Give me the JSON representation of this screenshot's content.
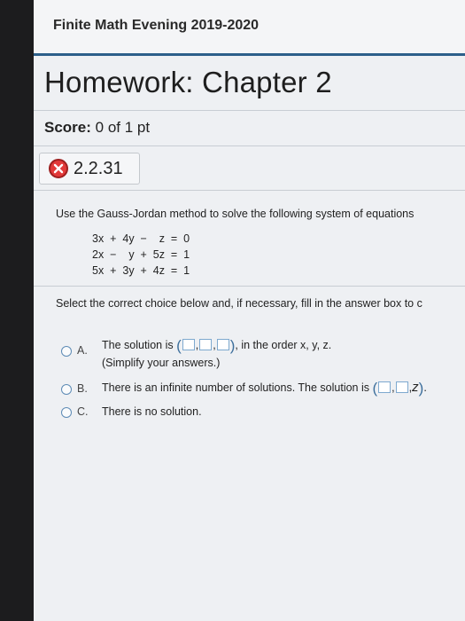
{
  "course": {
    "title": "Finite Math Evening 2019-2020"
  },
  "homework": {
    "title": "Homework: Chapter 2"
  },
  "score": {
    "label": "Score:",
    "value": "0 of 1 pt"
  },
  "question": {
    "id": "2.2.31",
    "status_icon": "incorrect-x-icon",
    "prompt": "Use the Gauss-Jordan method to solve the following system of equations",
    "equations": [
      "3x  +  4y  −    z  =  0",
      "2x  −    y  +  5z  =  1",
      "5x  +  3y  +  4z  =  1"
    ],
    "instruction": "Select the correct choice below and, if necessary, fill in the answer box to c"
  },
  "choices": {
    "a": {
      "letter": "A.",
      "text_before": "The solution is",
      "text_after": ", in the order x, y, z.",
      "note": "(Simplify your answers.)"
    },
    "b": {
      "letter": "B.",
      "text": "There is an infinite number of solutions. The solution is",
      "var": "z",
      "tail": "."
    },
    "c": {
      "letter": "C.",
      "text": "There is no solution."
    }
  },
  "colors": {
    "accent": "#2c5f8a",
    "incorrect": "#e23a3a",
    "radio": "#5d8bb5"
  }
}
